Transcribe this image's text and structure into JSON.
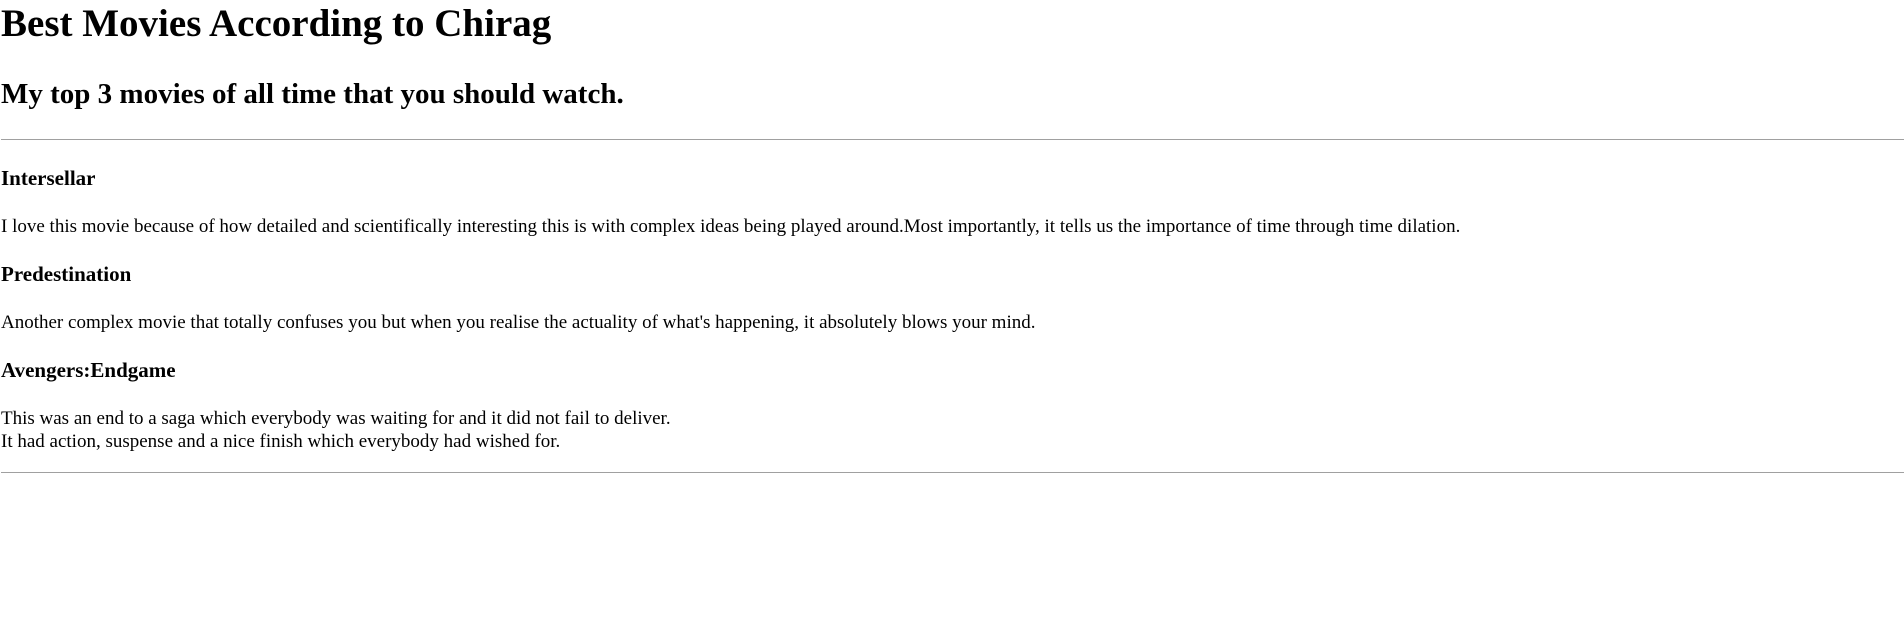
{
  "header": {
    "title": "Best Movies According to Chirag",
    "subtitle": "My top 3 movies of all time that you should watch."
  },
  "movies": [
    {
      "title": "Intersellar",
      "description": "I love this movie because of how detailed and scientifically interesting this is with complex ideas being played around.Most importantly, it tells us the importance of time through time dilation."
    },
    {
      "title": "Predestination",
      "description": "Another complex movie that totally confuses you but when you realise the actuality of what's happening, it absolutely blows your mind."
    },
    {
      "title": "Avengers:Endgame",
      "description_line1": "This was an end to a saga which everybody was waiting for and it did not fail to deliver.",
      "description_line2": "It had action, suspense and a nice finish which everybody had wished for."
    }
  ]
}
